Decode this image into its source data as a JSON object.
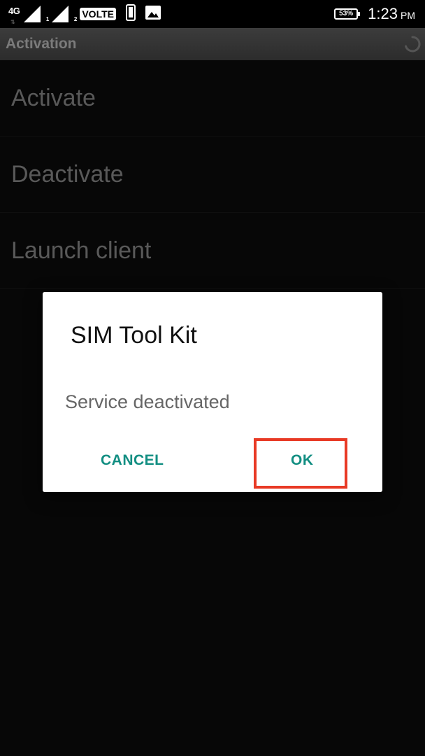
{
  "status_bar": {
    "network_type": "4G",
    "network_arrows": "⇅",
    "sim1_label": "1",
    "sim2_label": "2",
    "volte_label": "VOLTE",
    "battery_percent": "53%",
    "time": "1:23",
    "ampm": "PM"
  },
  "action_bar": {
    "title": "Activation"
  },
  "list": {
    "items": [
      {
        "label": "Activate"
      },
      {
        "label": "Deactivate"
      },
      {
        "label": "Launch client"
      }
    ]
  },
  "dialog": {
    "title": "SIM Tool Kit",
    "message": "Service deactivated",
    "cancel_label": "CANCEL",
    "ok_label": "OK"
  },
  "colors": {
    "accent": "#128e82",
    "highlight": "#e83a25",
    "list_text": "#777777",
    "action_bar_title": "#7b7b7b"
  }
}
